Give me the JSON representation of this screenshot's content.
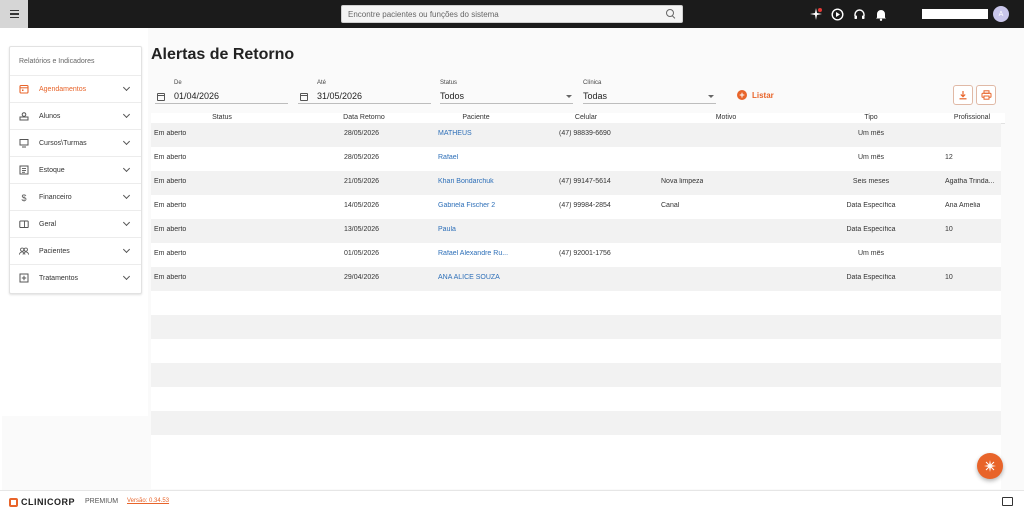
{
  "header": {
    "search_placeholder": "Encontre pacientes ou funções do sistema",
    "avatar_initial": "A"
  },
  "sidebar": {
    "title": "Relatórios e Indicadores",
    "items": [
      {
        "label": "Agendamentos",
        "icon": "calendar-icon",
        "active": true
      },
      {
        "label": "Alunos",
        "icon": "hand-icon"
      },
      {
        "label": "Cursos\\Turmas",
        "icon": "monitor-icon"
      },
      {
        "label": "Estoque",
        "icon": "list-icon"
      },
      {
        "label": "Financeiro",
        "icon": "dollar-icon"
      },
      {
        "label": "Geral",
        "icon": "card-icon"
      },
      {
        "label": "Pacientes",
        "icon": "people-icon"
      },
      {
        "label": "Tratamentos",
        "icon": "plus-box-icon"
      }
    ]
  },
  "main": {
    "title": "Alertas de Retorno",
    "filters": {
      "de_label": "De",
      "de_value": "01/04/2026",
      "ate_label": "Até",
      "ate_value": "31/05/2026",
      "status_label": "Status",
      "status_value": "Todos",
      "clinica_label": "Clínica",
      "clinica_value": "Todas",
      "listar_label": "Listar"
    },
    "columns": [
      "Status",
      "Data Retorno",
      "Paciente",
      "Celular",
      "Motivo",
      "Tipo",
      "Profissional"
    ],
    "rows": [
      {
        "status": "Em aberto",
        "data": "28/05/2026",
        "paciente": "MATHEUS",
        "celular": "(47) 98839-6690",
        "motivo": "",
        "tipo": "Um mês",
        "profissional": ""
      },
      {
        "status": "Em aberto",
        "data": "28/05/2026",
        "paciente": "Rafael",
        "celular": "",
        "motivo": "",
        "tipo": "Um mês",
        "profissional": "12"
      },
      {
        "status": "Em aberto",
        "data": "21/05/2026",
        "paciente": "Khari Bondarchuk",
        "celular": "(47) 99147-5614",
        "motivo": "Nova limpeza",
        "tipo": "Seis meses",
        "profissional": "Ágatha Trinda..."
      },
      {
        "status": "Em aberto",
        "data": "14/05/2026",
        "paciente": "Gabriela Fischer 2",
        "celular": "(47) 99984-2854",
        "motivo": "Canal",
        "tipo": "Data Específica",
        "profissional": "Ana Amelia"
      },
      {
        "status": "Em aberto",
        "data": "13/05/2026",
        "paciente": "Paula",
        "celular": "",
        "motivo": "",
        "tipo": "Data Específica",
        "profissional": "10"
      },
      {
        "status": "Em aberto",
        "data": "01/05/2026",
        "paciente": "Rafael Alexandre Ru...",
        "celular": "(47) 92001-1756",
        "motivo": "",
        "tipo": "Um mês",
        "profissional": ""
      },
      {
        "status": "Em aberto",
        "data": "29/04/2026",
        "paciente": "ANA ALICE SOUZA",
        "celular": "",
        "motivo": "",
        "tipo": "Data Específica",
        "profissional": "10"
      }
    ]
  },
  "footer": {
    "brand": "CLINICORP",
    "edition": "PREMIUM",
    "version": "Versão: 0.34.53"
  },
  "colors": {
    "accent": "#e8642a",
    "link": "#2d6fb8",
    "topbar": "#1b1b1b"
  }
}
